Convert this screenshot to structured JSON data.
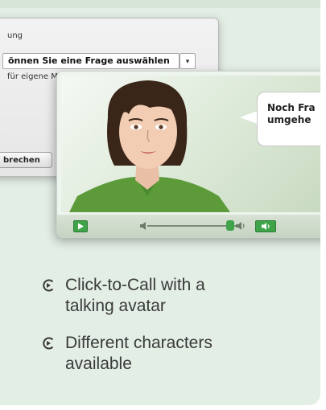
{
  "form_dialog": {
    "label": "ung",
    "select_value": "önnen Sie eine Frage auswählen",
    "select_arrow": "▾",
    "hint": "für eigene Mitteilung",
    "cancel_label": "brechen"
  },
  "avatar_window": {
    "speech_bubble": "Noch Fra\numgehe"
  },
  "features": [
    {
      "text": "Click-to-Call with a\ntalking avatar"
    },
    {
      "text": "Different characters\navailable"
    }
  ],
  "colors": {
    "card_background": "#e3eee5",
    "accent_green": "#3fa34a",
    "text": "#3a3a3a"
  },
  "icons": {
    "bullet": "arrow-circle-icon",
    "play": "play-icon",
    "volume": "speaker-icon"
  }
}
